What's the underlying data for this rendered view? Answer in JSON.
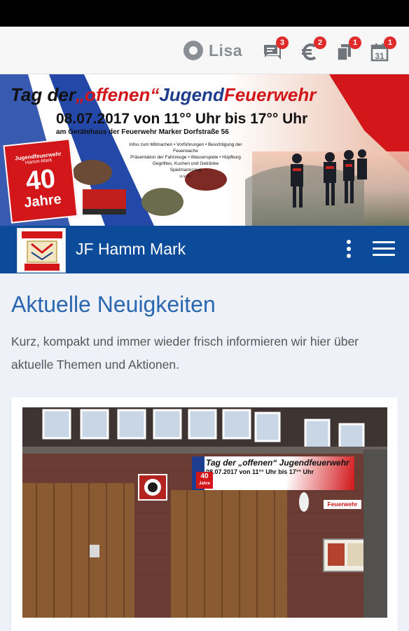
{
  "topbar": {
    "brand_name": "Lisa",
    "icons": [
      {
        "name": "chat-icon",
        "badge": "3"
      },
      {
        "name": "euro-icon",
        "badge": "2"
      },
      {
        "name": "documents-icon",
        "badge": "1"
      },
      {
        "name": "calendar-icon",
        "badge": "1",
        "calendar_day": "31"
      }
    ]
  },
  "banner": {
    "title_prefix": "Tag der",
    "title_offenen": "„offenen“",
    "title_jugend": "Jugend",
    "title_feuerwehr": "Feuerwehr",
    "date_line": "08.07.2017 von 11°° Uhr bis 17°° Uhr",
    "venue_line": "am Gerätehaus der Feuerwehr Marker Dorfstraße 56",
    "program": [
      "Infos zum Mitmachen • Vorführungen • Besichtigung der Feuerwache",
      "Präsentation der Fahrzeuge • Wasserspiele • Hüpfburg",
      "Gegrilltes, Kuchen und Getränke",
      "Spielmannszug",
      "u.v.m."
    ],
    "badge_title": "Jugendfeuerwehr",
    "badge_sub": "Hamm-Mark",
    "badge_number": "40",
    "badge_years": "Jahre"
  },
  "navbar": {
    "title": "JF Hamm Mark"
  },
  "main": {
    "section_title": "Aktuelle Neuigkeiten",
    "section_intro": "Kurz, kompakt und immer wieder frisch informieren wir hier über aktuelle Themen und Aktionen.",
    "photo_banner_title": "Tag der „offenen“ Jugendfeuerwehr",
    "photo_banner_date": "08.07.2017 von 11°° Uhr bis 17°° Uhr",
    "photo_badge_number": "40",
    "photo_badge_years": "Jahre",
    "photo_sign": "Feuerwehr"
  },
  "colors": {
    "accent_blue": "#0c4a9a",
    "title_blue": "#2a67b1",
    "badge_red": "#e02b2b"
  }
}
